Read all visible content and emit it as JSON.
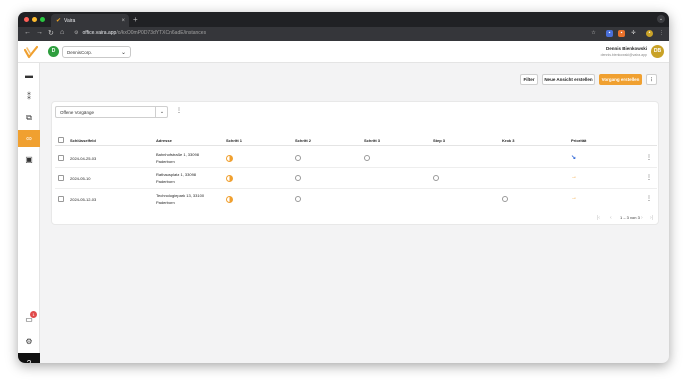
{
  "browser": {
    "tab_title": "Vaira",
    "tab_close": "×",
    "new_tab": "+",
    "url_host": "office.vaira.app",
    "url_path": "/o/kxO0mP0D73dYTXCn6adE/instances"
  },
  "header": {
    "org_avatar": "D",
    "org_name": "DennisCorp.",
    "user_name": "Dennis Bienkowski",
    "user_email": "dennis.bienkowski@vaira.app",
    "user_initials": "DB"
  },
  "sidebar": {
    "inbox_badge": "1",
    "help_label": "?"
  },
  "toolbar": {
    "filter_label": "Filter",
    "new_view_label": "Neue Ansicht erstellen",
    "create_label": "Vorgang erstellen"
  },
  "view": {
    "selected": "Offene Vorgänge"
  },
  "table": {
    "columns": [
      "Schlüsselfeld",
      "Adresse",
      "Schritt 1",
      "Schritt 2",
      "Schritt 3",
      "Step 3",
      "Krok 3",
      "Priorität"
    ],
    "rows": [
      {
        "key": "2024-04-25-03",
        "address_line1": "Bahnhofstraße 1, 33098",
        "address_line2": "Paderborn",
        "priority": "↘",
        "priority_color": "#3b6fd8"
      },
      {
        "key": "2024-05-10",
        "address_line1": "Rathausplatz 1, 33098",
        "address_line2": "Paderborn",
        "priority": "→",
        "priority_color": "#f0a030"
      },
      {
        "key": "2024-05-12-03",
        "address_line1": "Technologiepark 13, 33100",
        "address_line2": "Paderborn",
        "priority": "→",
        "priority_color": "#f0a030"
      }
    ]
  },
  "pagination": {
    "range": "1 – 3 von 3",
    "first": "|‹",
    "prev": "‹",
    "next": "›",
    "last": "›|"
  },
  "colors": {
    "accent": "#f0a030",
    "org_green": "#2e9e3e",
    "user_gold": "#c9a227"
  }
}
